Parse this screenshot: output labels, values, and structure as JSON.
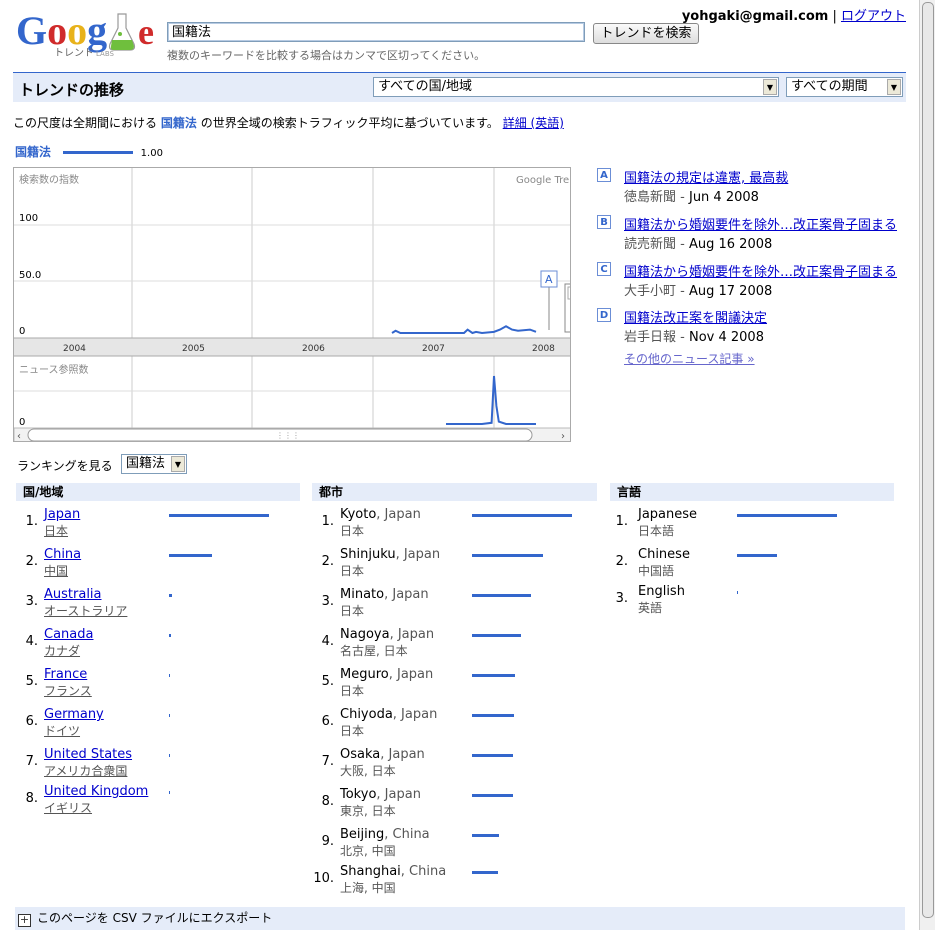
{
  "header": {
    "logo_text": "Google",
    "logo_sub": "トレンド",
    "logo_labs": "LABS",
    "search_value": "国籍法",
    "search_button": "トレンドを検索",
    "hint": "複数のキーワードを比較する場合はカンマで区切ってください。",
    "user_email": "yohgaki@gmail.com",
    "separator": "|",
    "logout": "ログアウト"
  },
  "titlebar": {
    "title": "トレンドの推移",
    "region_select": "すべての国/地域",
    "period_select": "すべての期間"
  },
  "description": {
    "prefix": "この尺度は全期間における",
    "keyword": "国籍法",
    "suffix": "の世界全域の検索トラフィック平均に基づいています。",
    "link": "詳細 (英語)"
  },
  "legend": {
    "keyword": "国籍法",
    "value": "1.00"
  },
  "chart": {
    "search_label": "検索数の指数",
    "watermark": "Google Tren",
    "y_ticks": [
      "100",
      "50.0",
      "0"
    ],
    "x_years": [
      "2004",
      "2005",
      "2006",
      "2007",
      "2008"
    ],
    "news_label": "ニュース参照数",
    "news_y": "0",
    "marker": "A"
  },
  "chart_data": {
    "type": "line",
    "title": "",
    "series": [
      {
        "name": "国籍法",
        "panel": "search",
        "points": [
          [
            2007.15,
            0
          ],
          [
            2007.18,
            2
          ],
          [
            2007.22,
            0
          ],
          [
            2007.6,
            0
          ],
          [
            2007.75,
            0
          ],
          [
            2007.78,
            3
          ],
          [
            2007.82,
            0
          ],
          [
            2007.85,
            1
          ],
          [
            2007.9,
            0
          ],
          [
            2008.0,
            1
          ],
          [
            2008.05,
            3
          ],
          [
            2008.1,
            6
          ],
          [
            2008.15,
            3
          ],
          [
            2008.2,
            2
          ],
          [
            2008.3,
            3
          ],
          [
            2008.35,
            1
          ]
        ]
      },
      {
        "name": "ニュース参照数",
        "panel": "news",
        "points": [
          [
            2007.6,
            0
          ],
          [
            2007.9,
            0
          ],
          [
            2007.98,
            1
          ],
          [
            2008.0,
            40
          ],
          [
            2008.02,
            15
          ],
          [
            2008.04,
            2
          ],
          [
            2008.1,
            0
          ],
          [
            2008.35,
            0
          ]
        ]
      }
    ],
    "ylim": [
      0,
      100
    ],
    "xlim": [
      2003.5,
      2008.25
    ]
  },
  "news": [
    {
      "letter": "A",
      "headline": "国籍法の規定は違憲, 最高裁",
      "source": "徳島新聞",
      "date": "Jun 4 2008"
    },
    {
      "letter": "B",
      "headline": "国籍法から婚姻要件を除外…改正案骨子固まる",
      "source": "読売新聞",
      "date": "Aug 16 2008"
    },
    {
      "letter": "C",
      "headline": "国籍法から婚姻要件を除外…改正案骨子固まる",
      "source": "大手小町",
      "date": "Aug 17 2008"
    },
    {
      "letter": "D",
      "headline": "国籍法改正案を閣議決定",
      "source": "岩手日報",
      "date": "Nov 4 2008"
    }
  ],
  "more_news": "その他のニュース記事 »",
  "ranking": {
    "label": "ランキングを見る",
    "select": "国籍法",
    "regions_title": "国/地域",
    "cities_title": "都市",
    "languages_title": "言語",
    "regions": [
      {
        "rank": "1.",
        "name": "Japan",
        "sub": "日本",
        "value": 1.0
      },
      {
        "rank": "2.",
        "name": "China",
        "sub": "中国",
        "value": 0.43
      },
      {
        "rank": "3.",
        "name": "Australia",
        "sub": "オーストラリア",
        "value": 0.03
      },
      {
        "rank": "4.",
        "name": "Canada",
        "sub": "カナダ",
        "value": 0.02
      },
      {
        "rank": "5.",
        "name": "France",
        "sub": "フランス",
        "value": 0.01
      },
      {
        "rank": "6.",
        "name": "Germany",
        "sub": "ドイツ",
        "value": 0.01
      },
      {
        "rank": "7.",
        "name": "United States",
        "sub": "アメリカ合衆国",
        "value": 0.01
      },
      {
        "rank": "8.",
        "name": "United Kingdom",
        "sub": "イギリス",
        "value": 0.01
      }
    ],
    "cities": [
      {
        "rank": "1.",
        "city": "Kyoto",
        "country": ", Japan",
        "sub": "日本",
        "value": 1.0
      },
      {
        "rank": "2.",
        "city": "Shinjuku",
        "country": ", Japan",
        "sub": "日本",
        "value": 0.71
      },
      {
        "rank": "3.",
        "city": "Minato",
        "country": ", Japan",
        "sub": "日本",
        "value": 0.59
      },
      {
        "rank": "4.",
        "city": "Nagoya",
        "country": ", Japan",
        "sub": "名古屋, 日本",
        "value": 0.49
      },
      {
        "rank": "5.",
        "city": "Meguro",
        "country": ", Japan",
        "sub": "日本",
        "value": 0.43
      },
      {
        "rank": "6.",
        "city": "Chiyoda",
        "country": ", Japan",
        "sub": "日本",
        "value": 0.42
      },
      {
        "rank": "7.",
        "city": "Osaka",
        "country": ", Japan",
        "sub": "大阪, 日本",
        "value": 0.41
      },
      {
        "rank": "8.",
        "city": "Tokyo",
        "country": ", Japan",
        "sub": "東京, 日本",
        "value": 0.41
      },
      {
        "rank": "9.",
        "city": "Beijing",
        "country": ", China",
        "sub": "北京, 中国",
        "value": 0.27
      },
      {
        "rank": "10.",
        "city": "Shanghai",
        "country": ", China",
        "sub": "上海, 中国",
        "value": 0.26
      }
    ],
    "languages": [
      {
        "rank": "1.",
        "name": "Japanese",
        "sub": "日本語",
        "value": 1.0
      },
      {
        "rank": "2.",
        "name": "Chinese",
        "sub": "中国語",
        "value": 0.4
      },
      {
        "rank": "3.",
        "name": "English",
        "sub": "英語",
        "value": 0.01
      }
    ]
  },
  "export": "このページを CSV ファイルにエクスポート",
  "colors": {
    "accent": "#3366cc",
    "panel": "#e5ecf9",
    "link": "#0000cc"
  }
}
